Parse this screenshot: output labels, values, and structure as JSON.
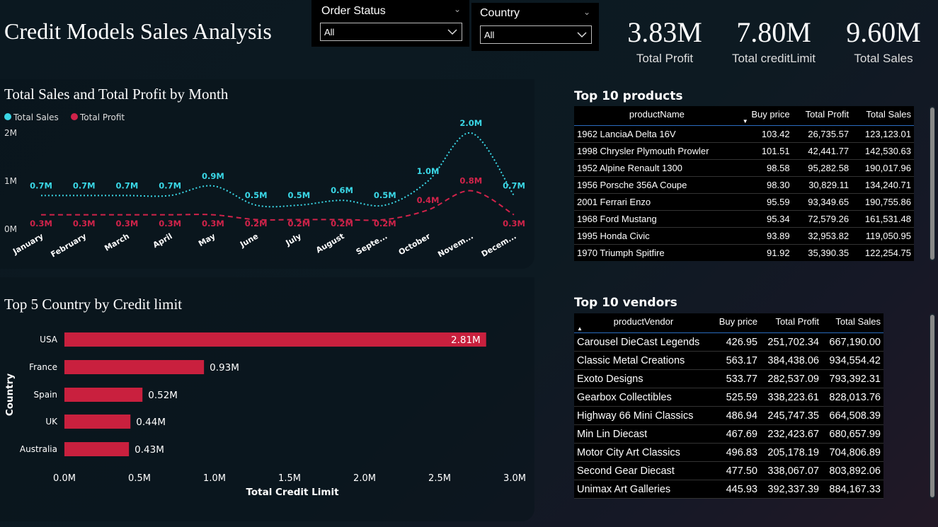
{
  "header": {
    "title": "Credit Models Sales Analysis"
  },
  "slicers": [
    {
      "label": "Order Status",
      "value": "All"
    },
    {
      "label": "Country",
      "value": "All"
    }
  ],
  "kpis": [
    {
      "value": "3.83M",
      "label": "Total Profit"
    },
    {
      "value": "7.80M",
      "label": "Total creditLimit"
    },
    {
      "value": "9.60M",
      "label": "Total Sales"
    }
  ],
  "colors": {
    "sales": "#3ad7e6",
    "profit": "#d0234a",
    "bar": "#c9203e",
    "header_line": "#2a6cbf"
  },
  "chart_data": [
    {
      "type": "line",
      "title": "Total Sales and Total Profit by Month",
      "legend": [
        "Total Sales",
        "Total Profit"
      ],
      "legend_placement": "top-left",
      "categories": [
        "January",
        "February",
        "March",
        "April",
        "May",
        "June",
        "July",
        "August",
        "Septe...",
        "October",
        "Novem...",
        "Decem..."
      ],
      "ylim": [
        0,
        2
      ],
      "yticks": [
        "0M",
        "1M",
        "2M"
      ],
      "series": [
        {
          "name": "Total Sales",
          "values": [
            0.7,
            0.7,
            0.7,
            0.7,
            0.9,
            0.5,
            0.5,
            0.6,
            0.5,
            1.0,
            2.0,
            0.7
          ],
          "labels": [
            "0.7M",
            "0.7M",
            "0.7M",
            "0.7M",
            "0.9M",
            "0.5M",
            "0.5M",
            "0.6M",
            "0.5M",
            "1.0M",
            "2.0M",
            "0.7M"
          ]
        },
        {
          "name": "Total Profit",
          "values": [
            0.3,
            0.3,
            0.3,
            0.3,
            0.3,
            0.2,
            0.2,
            0.2,
            0.2,
            0.4,
            0.8,
            0.3
          ],
          "labels": [
            "0.3M",
            "0.3M",
            "0.3M",
            "0.3M",
            "0.3M",
            "0.2M",
            "0.2M",
            "0.2M",
            "0.2M",
            "0.4M",
            "0.8M",
            "0.3M"
          ]
        }
      ]
    },
    {
      "type": "bar",
      "orientation": "horizontal",
      "title": "Top 5 Country by Credit limit",
      "categories": [
        "USA",
        "France",
        "Spain",
        "UK",
        "Australia"
      ],
      "values": [
        2.81,
        0.93,
        0.52,
        0.44,
        0.43
      ],
      "labels": [
        "2.81M",
        "0.93M",
        "0.52M",
        "0.44M",
        "0.43M"
      ],
      "xlabel": "Total Credit Limit",
      "ylabel": "Country",
      "xlim": [
        0,
        3
      ],
      "xticks": [
        "0.0M",
        "0.5M",
        "1.0M",
        "1.5M",
        "2.0M",
        "2.5M",
        "3.0M"
      ]
    }
  ],
  "products": {
    "title": "Top 10 products",
    "columns": [
      "productName",
      "Buy price",
      "Total Profit",
      "Total Sales"
    ],
    "rows": [
      [
        "1962 LanciaA Delta 16V",
        "103.42",
        "26,735.57",
        "123,123.01"
      ],
      [
        "1998 Chrysler Plymouth Prowler",
        "101.51",
        "42,441.77",
        "142,530.63"
      ],
      [
        "1952 Alpine Renault 1300",
        "98.58",
        "95,282.58",
        "190,017.96"
      ],
      [
        "1956 Porsche 356A Coupe",
        "98.30",
        "30,829.11",
        "134,240.71"
      ],
      [
        "2001 Ferrari Enzo",
        "95.59",
        "93,349.65",
        "190,755.86"
      ],
      [
        "1968 Ford Mustang",
        "95.34",
        "72,579.26",
        "161,531.48"
      ],
      [
        "1995 Honda Civic",
        "93.89",
        "32,953.82",
        "119,050.95"
      ],
      [
        "1970 Triumph Spitfire",
        "91.92",
        "35,390.35",
        "122,254.75"
      ]
    ]
  },
  "vendors": {
    "title": "Top 10 vendors",
    "columns": [
      "productVendor",
      "Buy price",
      "Total Profit",
      "Total Sales"
    ],
    "rows": [
      [
        "Carousel DieCast Legends",
        "426.95",
        "251,702.34",
        "667,190.00"
      ],
      [
        "Classic Metal Creations",
        "563.17",
        "384,438.06",
        "934,554.42"
      ],
      [
        "Exoto Designs",
        "533.77",
        "282,537.09",
        "793,392.31"
      ],
      [
        "Gearbox Collectibles",
        "525.59",
        "338,223.61",
        "828,013.76"
      ],
      [
        "Highway 66 Mini Classics",
        "486.94",
        "245,747.35",
        "664,508.39"
      ],
      [
        "Min Lin Diecast",
        "467.69",
        "232,423.67",
        "680,657.99"
      ],
      [
        "Motor City Art Classics",
        "496.83",
        "205,178.19",
        "704,806.89"
      ],
      [
        "Second Gear Diecast",
        "477.50",
        "338,067.07",
        "803,892.06"
      ],
      [
        "Unimax Art Galleries",
        "445.93",
        "392,337.39",
        "884,167.33"
      ]
    ]
  }
}
